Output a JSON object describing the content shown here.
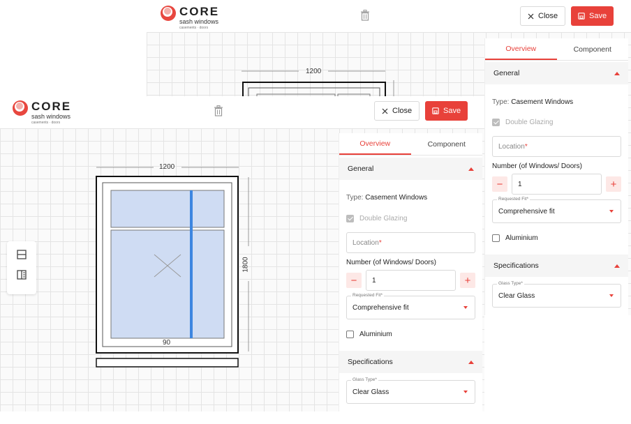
{
  "brand": {
    "name": "CORE",
    "tagline": "sash windows",
    "sub": "casements · doors",
    "accent": "#e8413a"
  },
  "header": {
    "close_label": "Close",
    "save_label": "Save",
    "delete_icon": "trash-icon"
  },
  "panel": {
    "tabs": [
      {
        "label": "Overview",
        "active": true
      },
      {
        "label": "Component",
        "active": false
      }
    ],
    "general": {
      "title": "General",
      "type_prefix": "Type:",
      "type_value": "Casement Windows",
      "double_glazing_label": "Double Glazing",
      "double_glazing_checked": true,
      "location_placeholder": "Location",
      "required_mark": "*",
      "number_label": "Number (of Windows/ Doors)",
      "number_value": "1",
      "minus": "−",
      "plus": "+",
      "requested_fit_label": "Requested Fit*",
      "requested_fit_value": "Comprehensive fit",
      "aluminium_label": "Aluminium",
      "aluminium_checked": false
    },
    "specifications": {
      "title": "Specifications",
      "glass_type_label": "Glass Type*",
      "glass_type_value": "Clear Glass"
    }
  },
  "drawing": {
    "width_label": "1200",
    "height_label": "1800",
    "bottom_label": "90"
  },
  "tools": [
    "horizontal-split-icon",
    "vertical-split-icon"
  ]
}
